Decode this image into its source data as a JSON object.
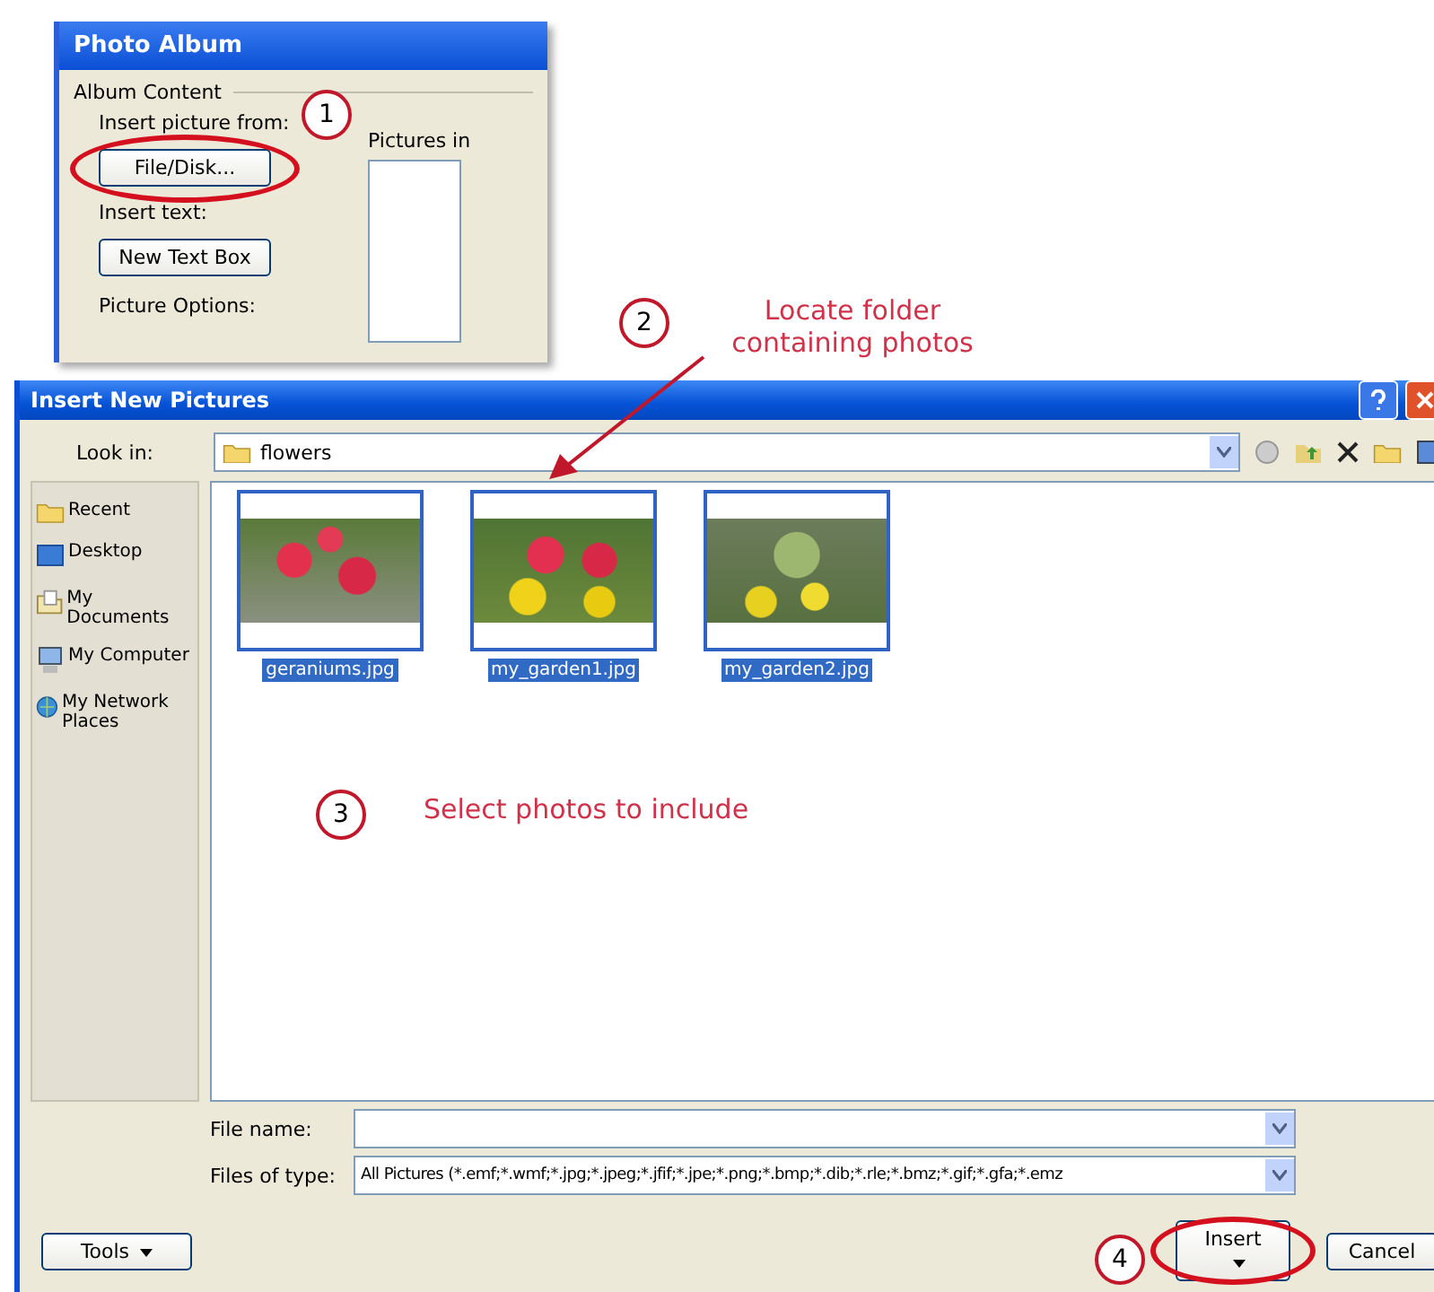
{
  "album_window": {
    "title": "Photo Album",
    "group": "Album Content",
    "insert_picture_label": "Insert picture from:",
    "file_disk_button": "File/Disk...",
    "insert_text_label": "Insert text:",
    "new_text_box_button": "New Text Box",
    "picture_options_label": "Picture Options:",
    "pictures_in_label": "Pictures in"
  },
  "steps": [
    {
      "number": "1"
    },
    {
      "number": "2",
      "note": "Locate folder containing photos"
    },
    {
      "number": "3",
      "note": "Select photos to include"
    },
    {
      "number": "4"
    }
  ],
  "dialog": {
    "title": "Insert New Pictures",
    "look_in_label": "Look in:",
    "folder": "flowers",
    "places": [
      {
        "label": "Recent",
        "kind": "recent"
      },
      {
        "label": "Desktop",
        "kind": "desktop"
      },
      {
        "label": "My Documents",
        "kind": "documents"
      },
      {
        "label": "My Computer",
        "kind": "computer"
      },
      {
        "label": "My Network Places",
        "kind": "network"
      }
    ],
    "files": [
      {
        "name": "geraniums.jpg",
        "selected": true
      },
      {
        "name": "my_garden1.jpg",
        "selected": true
      },
      {
        "name": "my_garden2.jpg",
        "selected": true
      }
    ],
    "file_name_label": "File name:",
    "files_of_type_label": "Files of type:",
    "files_of_type": "All Pictures (*.emf;*.wmf;*.jpg;*.jpeg;*.jfif;*.jpe;*.png;*.bmp;*.dib;*.rle;*.bmz;*.gif;*.gfa;*.emz",
    "tools_button": "Tools",
    "insert_button": "Insert",
    "cancel_button": "Cancel"
  }
}
